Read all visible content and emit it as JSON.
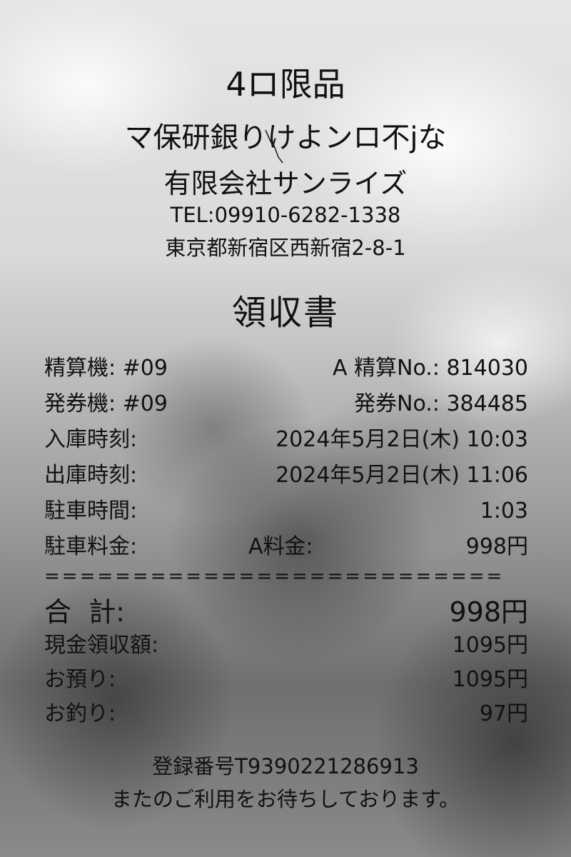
{
  "header": {
    "line1": "4ロ限品",
    "line2": "マ保研銀りけよンロ不jな",
    "company": "有限会社サンライズ",
    "tel": "TEL:09910-6282-1338",
    "address": "東京都新宿区西新宿2-8-1"
  },
  "title": "領収書",
  "rows": {
    "machine": {
      "label": "精算機: #09",
      "value": "A 精算No.: 814030"
    },
    "ticket_machine": {
      "label": "発券機: #09",
      "value": "発券No.: 384485"
    },
    "entry": {
      "label": "入庫時刻:",
      "value": "2024年5月2日(木) 10:03"
    },
    "exit": {
      "label": "出庫時刻:",
      "value": "2024年5月2日(木) 11:06"
    },
    "duration": {
      "label": "駐車時間:",
      "value": "1:03"
    },
    "fee": {
      "label": "駐車料金:",
      "mid": "A料金:",
      "value": "998円"
    }
  },
  "divider": "==========================",
  "totals": {
    "total": {
      "label": "合  計:",
      "value": "998円"
    },
    "cash_received": {
      "label": "現金領収額:",
      "value": "1095円"
    },
    "deposit": {
      "label": "お預り:",
      "value": "1095円"
    },
    "change": {
      "label": "お釣り:",
      "value": "97円"
    }
  },
  "footer": {
    "registration": "登録番号T9390221286913",
    "thanks": "またのご利用をお待ちしております。"
  }
}
